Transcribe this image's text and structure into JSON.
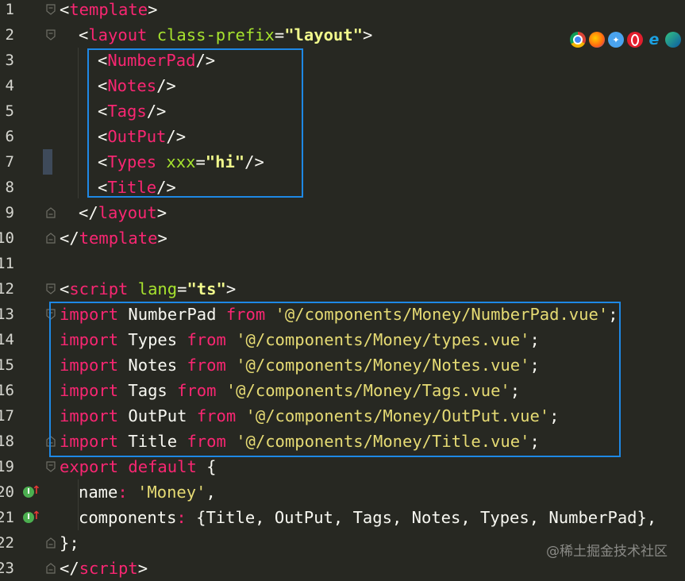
{
  "colors": {
    "background": "#272822",
    "tag": "#f92672",
    "attr": "#a6e22e",
    "string": "#f1fa8c",
    "box": "#1e88e5"
  },
  "browser_icons": [
    "chrome-icon",
    "firefox-icon",
    "safari-icon",
    "opera-icon",
    "ie-icon",
    "edge-icon"
  ],
  "editor": {
    "lines": [
      {
        "n": "1",
        "fold": "open",
        "indent": 0,
        "tokens": [
          [
            "p",
            "<"
          ],
          [
            "tag",
            "template"
          ],
          [
            "p",
            ">"
          ]
        ]
      },
      {
        "n": "2",
        "fold": "open",
        "indent": 1,
        "tokens": [
          [
            "p",
            "<"
          ],
          [
            "tag",
            "layout"
          ],
          [
            "p",
            " "
          ],
          [
            "attr",
            "class-prefix"
          ],
          [
            "p",
            "="
          ],
          [
            "str",
            "\"layout\""
          ],
          [
            "p",
            ">"
          ]
        ]
      },
      {
        "n": "3",
        "fold": "",
        "indent": 2,
        "tokens": [
          [
            "p",
            "<"
          ],
          [
            "tag",
            "NumberPad"
          ],
          [
            "p",
            "/>"
          ]
        ]
      },
      {
        "n": "4",
        "fold": "",
        "indent": 2,
        "tokens": [
          [
            "p",
            "<"
          ],
          [
            "tag",
            "Notes"
          ],
          [
            "p",
            "/>"
          ]
        ]
      },
      {
        "n": "5",
        "fold": "",
        "indent": 2,
        "tokens": [
          [
            "p",
            "<"
          ],
          [
            "tag",
            "Tags"
          ],
          [
            "p",
            "/>"
          ]
        ]
      },
      {
        "n": "6",
        "fold": "",
        "indent": 2,
        "tokens": [
          [
            "p",
            "<"
          ],
          [
            "tag",
            "OutPut"
          ],
          [
            "p",
            "/>"
          ]
        ]
      },
      {
        "n": "7",
        "fold": "",
        "indent": 2,
        "tokens": [
          [
            "p",
            "<"
          ],
          [
            "tag",
            "Types"
          ],
          [
            "p",
            " "
          ],
          [
            "attr",
            "xxx"
          ],
          [
            "p",
            "="
          ],
          [
            "str",
            "\"hi\""
          ],
          [
            "p",
            "/>"
          ]
        ]
      },
      {
        "n": "8",
        "fold": "",
        "indent": 2,
        "tokens": [
          [
            "p",
            "<"
          ],
          [
            "tag",
            "Title"
          ],
          [
            "p",
            "/>"
          ]
        ]
      },
      {
        "n": "9",
        "fold": "close",
        "indent": 1,
        "tokens": [
          [
            "p",
            "</"
          ],
          [
            "tag",
            "layout"
          ],
          [
            "p",
            ">"
          ]
        ]
      },
      {
        "n": "10",
        "fold": "close",
        "indent": 0,
        "tokens": [
          [
            "p",
            "</"
          ],
          [
            "tag",
            "template"
          ],
          [
            "p",
            ">"
          ]
        ]
      },
      {
        "n": "11",
        "fold": "",
        "indent": 0,
        "tokens": []
      },
      {
        "n": "12",
        "fold": "open",
        "indent": 0,
        "tokens": [
          [
            "p",
            "<"
          ],
          [
            "tag",
            "script"
          ],
          [
            "p",
            " "
          ],
          [
            "attr",
            "lang"
          ],
          [
            "p",
            "="
          ],
          [
            "str",
            "\"ts\""
          ],
          [
            "p",
            ">"
          ]
        ]
      },
      {
        "n": "13",
        "fold": "open",
        "indent": 0,
        "tokens": [
          [
            "kw",
            "import"
          ],
          [
            "p",
            " NumberPad "
          ],
          [
            "kw",
            "from"
          ],
          [
            "p",
            " "
          ],
          [
            "str2",
            "'@/components/Money/NumberPad.vue'"
          ],
          [
            "p",
            ";"
          ]
        ]
      },
      {
        "n": "14",
        "fold": "",
        "indent": 0,
        "tokens": [
          [
            "kw",
            "import"
          ],
          [
            "p",
            " Types "
          ],
          [
            "kw",
            "from"
          ],
          [
            "p",
            " "
          ],
          [
            "str2",
            "'@/components/Money/types.vue'"
          ],
          [
            "p",
            ";"
          ]
        ]
      },
      {
        "n": "15",
        "fold": "",
        "indent": 0,
        "tokens": [
          [
            "kw",
            "import"
          ],
          [
            "p",
            " Notes "
          ],
          [
            "kw",
            "from"
          ],
          [
            "p",
            " "
          ],
          [
            "str2",
            "'@/components/Money/Notes.vue'"
          ],
          [
            "p",
            ";"
          ]
        ]
      },
      {
        "n": "16",
        "fold": "",
        "indent": 0,
        "tokens": [
          [
            "kw",
            "import"
          ],
          [
            "p",
            " Tags "
          ],
          [
            "kw",
            "from"
          ],
          [
            "p",
            " "
          ],
          [
            "str2",
            "'@/components/Money/Tags.vue'"
          ],
          [
            "p",
            ";"
          ]
        ]
      },
      {
        "n": "17",
        "fold": "",
        "indent": 0,
        "tokens": [
          [
            "kw",
            "import"
          ],
          [
            "p",
            " OutPut "
          ],
          [
            "kw",
            "from"
          ],
          [
            "p",
            " "
          ],
          [
            "str2",
            "'@/components/Money/OutPut.vue'"
          ],
          [
            "p",
            ";"
          ]
        ]
      },
      {
        "n": "18",
        "fold": "close",
        "indent": 0,
        "tokens": [
          [
            "kw",
            "import"
          ],
          [
            "p",
            " Title "
          ],
          [
            "kw",
            "from"
          ],
          [
            "p",
            " "
          ],
          [
            "str2",
            "'@/components/Money/Title.vue'"
          ],
          [
            "p",
            ";"
          ]
        ]
      },
      {
        "n": "19",
        "fold": "open",
        "indent": 0,
        "tokens": [
          [
            "kw",
            "export"
          ],
          [
            "p",
            " "
          ],
          [
            "kw",
            "default"
          ],
          [
            "p",
            " {"
          ]
        ]
      },
      {
        "n": "20",
        "fold": "",
        "indent": 1,
        "marker": true,
        "tokens": [
          [
            "p",
            "name"
          ],
          [
            "kw",
            ":"
          ],
          [
            "p",
            " "
          ],
          [
            "str2",
            "'Money'"
          ],
          [
            "p",
            ","
          ]
        ]
      },
      {
        "n": "21",
        "fold": "",
        "indent": 1,
        "marker": true,
        "tokens": [
          [
            "p",
            "components"
          ],
          [
            "kw",
            ":"
          ],
          [
            "p",
            " {Title, OutPut, Tags, Notes, Types, NumberPad},"
          ]
        ]
      },
      {
        "n": "22",
        "fold": "close",
        "indent": 0,
        "tokens": [
          [
            "p",
            "};"
          ]
        ]
      },
      {
        "n": "23",
        "fold": "close",
        "indent": 0,
        "tokens": [
          [
            "p",
            "</"
          ],
          [
            "tag",
            "script"
          ],
          [
            "p",
            ">"
          ]
        ]
      }
    ]
  },
  "watermark": "@稀土掘金技术社区"
}
